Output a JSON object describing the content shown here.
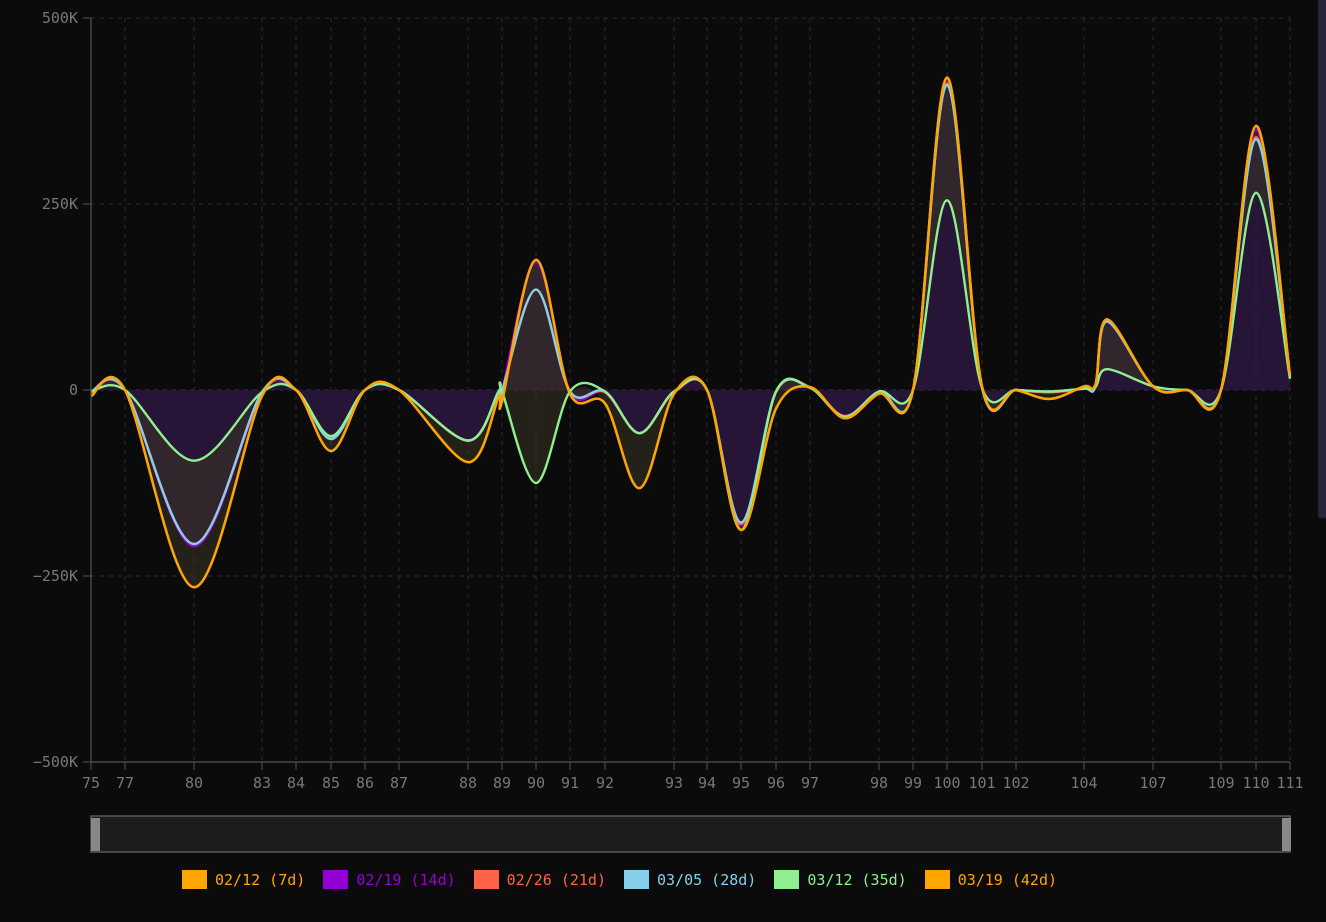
{
  "chart_data": {
    "type": "area",
    "title": "",
    "xlabel": "",
    "ylabel": "",
    "x_ticks": [
      "75",
      "77",
      "80",
      "83",
      "84",
      "85",
      "86",
      "87",
      "88",
      "89",
      "90",
      "91",
      "92",
      "93",
      "94",
      "95",
      "96",
      "97",
      "98",
      "99",
      "100",
      "101",
      "102",
      "104",
      "107",
      "109",
      "110",
      "111"
    ],
    "y_ticks": [
      "500K",
      "250K",
      "0",
      "−250K",
      "−500K"
    ],
    "ylim": [
      -500000,
      500000
    ],
    "grid": true,
    "legend_position": "bottom",
    "series": [
      {
        "name": "02/12 (7d)",
        "color": "#ffa500",
        "values": [
          -8000,
          0,
          -265000,
          -8000,
          0,
          -82000,
          0,
          0,
          -97000,
          -10000,
          -15000,
          175000,
          -5000,
          -18000,
          -132000,
          -5000,
          0,
          -188000,
          -25000,
          4000,
          -38000,
          -5000,
          0,
          420000,
          5000,
          0,
          -12000,
          5000,
          8000,
          95000,
          5000,
          0,
          0,
          355000,
          20000
        ]
      },
      {
        "name": "02/19 (14d)",
        "color": "#9400d3",
        "values": [
          -2000,
          0,
          -210000,
          -5000,
          0,
          -66000,
          0,
          0,
          -68000,
          -3000,
          -2000,
          172000,
          -2000,
          -3000,
          -58000,
          -3000,
          0,
          -182000,
          -3000,
          4000,
          -35000,
          -2000,
          0,
          418000,
          3000,
          0,
          -3000,
          2000,
          6000,
          92000,
          5000,
          0,
          0,
          350000,
          18000
        ]
      },
      {
        "name": "02/26 (21d)",
        "color": "#ff6347",
        "values": [
          -3000,
          0,
          -207000,
          -4000,
          0,
          -65000,
          0,
          0,
          -68000,
          -4000,
          -2000,
          135000,
          -2000,
          -3000,
          -58000,
          -3000,
          0,
          -180000,
          -3000,
          4000,
          -35000,
          -3000,
          0,
          412000,
          3000,
          0,
          -3000,
          2000,
          5000,
          93000,
          5000,
          0,
          0,
          340000,
          18000
        ]
      },
      {
        "name": "03/05 (28d)",
        "color": "#87ceeb",
        "values": [
          -2000,
          0,
          -207000,
          -3000,
          0,
          -66000,
          0,
          0,
          -68000,
          -2000,
          -1000,
          135000,
          -2000,
          -2000,
          -58000,
          -2000,
          0,
          -178000,
          -2000,
          3000,
          -36000,
          -2000,
          0,
          410000,
          3000,
          0,
          -2000,
          2000,
          5000,
          92000,
          5000,
          0,
          0,
          337000,
          17000
        ]
      },
      {
        "name": "03/12 (35d)",
        "color": "#90ee90",
        "values": [
          -2000,
          0,
          -95000,
          -3000,
          0,
          -62000,
          0,
          0,
          -68000,
          -2000,
          -2000,
          -125000,
          -2000,
          -2000,
          -58000,
          -2000,
          0,
          -188000,
          -2000,
          3000,
          -36000,
          -2000,
          0,
          255000,
          3000,
          0,
          -2000,
          2000,
          4000,
          28000,
          5000,
          0,
          0,
          265000,
          15000
        ]
      },
      {
        "name": "03/19 (42d)",
        "color": "#ffa500",
        "values": [
          -8000,
          0,
          -265000,
          -8000,
          0,
          -82000,
          0,
          0,
          -97000,
          -10000,
          -15000,
          175000,
          -5000,
          -18000,
          -132000,
          -5000,
          0,
          -188000,
          -25000,
          4000,
          -38000,
          -5000,
          0,
          420000,
          5000,
          0,
          -12000,
          5000,
          8000,
          95000,
          5000,
          0,
          0,
          355000,
          20000
        ]
      }
    ],
    "x": [
      75,
      77,
      80,
      83,
      84,
      85,
      86,
      87,
      88,
      88.9,
      89,
      90,
      91,
      92,
      92.5,
      93,
      94,
      95,
      96,
      97,
      97.5,
      98,
      99,
      100,
      101,
      102,
      103,
      104,
      104.5,
      105,
      107,
      108,
      109,
      110,
      111
    ]
  },
  "colors": {
    "background": "#0b0b0c",
    "grid": "#2c2c2c",
    "axis": "#555555",
    "tick_text": "#777777",
    "fill_positive": "#2b1740",
    "fill_band": "#3a3524",
    "zero_line": "#3a3a3a"
  }
}
